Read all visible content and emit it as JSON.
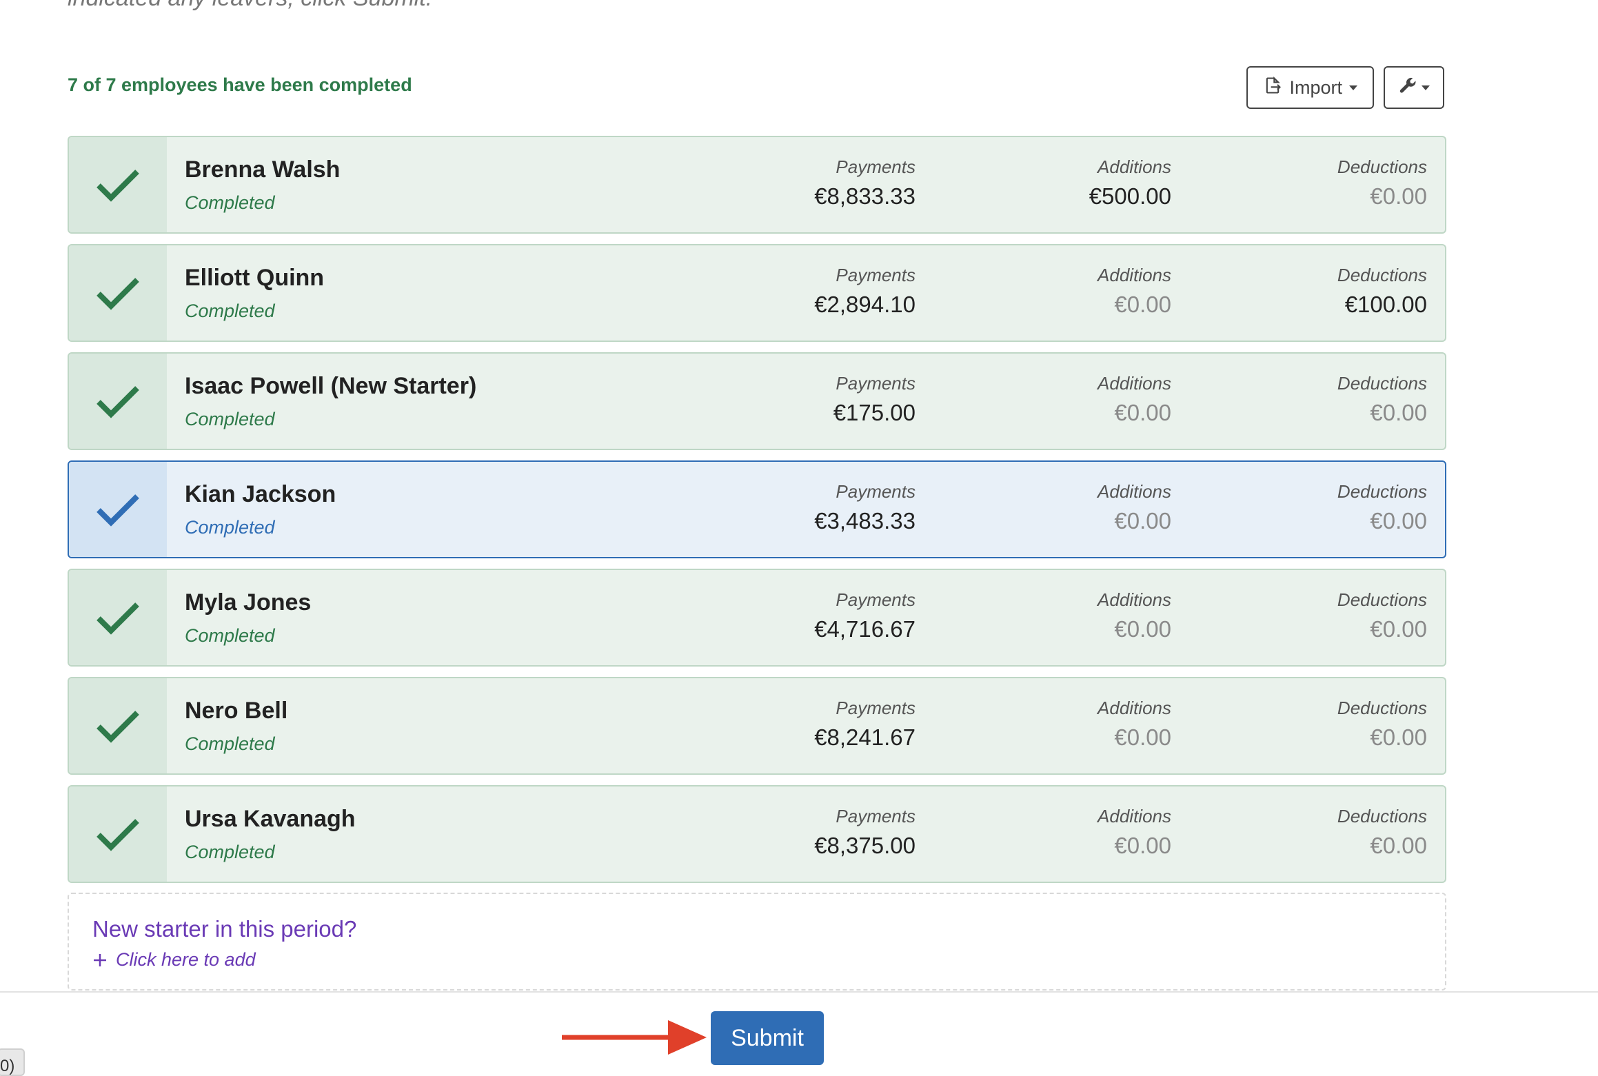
{
  "intro": {
    "text": "indicated any leavers, click Submit."
  },
  "summary": {
    "text": "7 of 7 employees have been completed"
  },
  "toolbar": {
    "import_label": "Import"
  },
  "labels": {
    "payments": "Payments",
    "additions": "Additions",
    "deductions": "Deductions"
  },
  "colors": {
    "success": "#2e7a4a",
    "primary": "#2f6db5",
    "accent_purple": "#6a3ab5",
    "arrow": "#e0402a"
  },
  "employees": [
    {
      "name": "Brenna Walsh",
      "status": "Completed",
      "payments": "€8,833.33",
      "additions": "€500.00",
      "deductions": "€0.00"
    },
    {
      "name": "Elliott Quinn",
      "status": "Completed",
      "payments": "€2,894.10",
      "additions": "€0.00",
      "deductions": "€100.00"
    },
    {
      "name": "Isaac Powell (New Starter)",
      "status": "Completed",
      "payments": "€175.00",
      "additions": "€0.00",
      "deductions": "€0.00"
    },
    {
      "name": "Kian Jackson",
      "status": "Completed",
      "payments": "€3,483.33",
      "additions": "€0.00",
      "deductions": "€0.00"
    },
    {
      "name": "Myla Jones",
      "status": "Completed",
      "payments": "€4,716.67",
      "additions": "€0.00",
      "deductions": "€0.00"
    },
    {
      "name": "Nero Bell",
      "status": "Completed",
      "payments": "€8,241.67",
      "additions": "€0.00",
      "deductions": "€0.00"
    },
    {
      "name": "Ursa Kavanagh",
      "status": "Completed",
      "payments": "€8,375.00",
      "additions": "€0.00",
      "deductions": "€0.00"
    }
  ],
  "new_starter": {
    "title": "New starter in this period?",
    "add_label": "Click here to add"
  },
  "submit": {
    "label": "Submit"
  },
  "corner": {
    "text": "0)"
  }
}
